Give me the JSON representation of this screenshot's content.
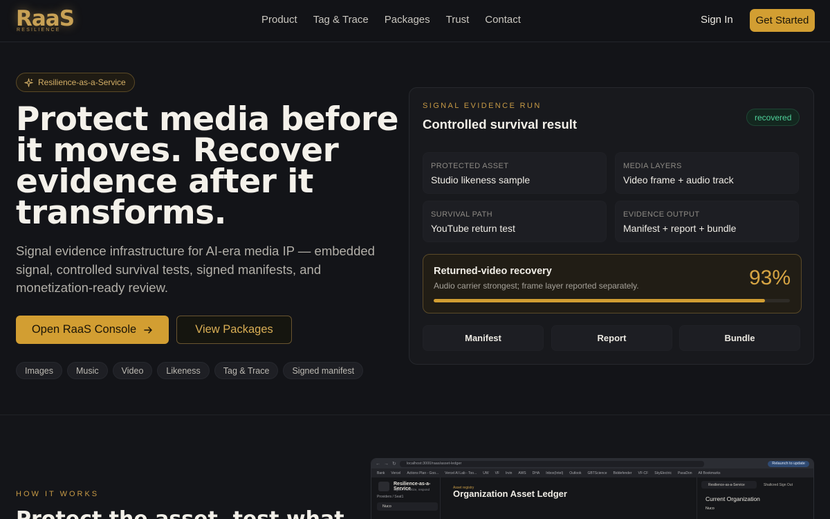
{
  "nav": {
    "logo": "RaaS",
    "logo_sub": "RESILIENCE",
    "links": [
      "Product",
      "Tag & Trace",
      "Packages",
      "Trust",
      "Contact"
    ],
    "sign_in": "Sign In",
    "get_started": "Get Started"
  },
  "hero": {
    "badge": "Resilience-as-a-Service",
    "title": "Protect media before it moves. Recover evidence after it transforms.",
    "subtitle": "Signal evidence infrastructure for AI-era media IP — embedded signal, controlled survival tests, signed manifests, and monetization-ready review.",
    "primary_button": "Open RaaS Console",
    "secondary_button": "View Packages",
    "tags": [
      "Images",
      "Music",
      "Video",
      "Likeness",
      "Tag & Trace",
      "Signed manifest"
    ]
  },
  "card": {
    "eyebrow": "SIGNAL EVIDENCE RUN",
    "title": "Controlled survival result",
    "status": "recovered",
    "stats": [
      {
        "label": "PROTECTED ASSET",
        "value": "Studio likeness sample"
      },
      {
        "label": "MEDIA LAYERS",
        "value": "Video frame + audio track"
      },
      {
        "label": "SURVIVAL PATH",
        "value": "YouTube return test"
      },
      {
        "label": "EVIDENCE OUTPUT",
        "value": "Manifest + report + bundle"
      }
    ],
    "recovery": {
      "title": "Returned-video recovery",
      "subtitle": "Audio carrier strongest; frame layer reported separately.",
      "percent_label": "93%",
      "progress": 0.93
    },
    "buttons": [
      "Manifest",
      "Report",
      "Bundle"
    ]
  },
  "how": {
    "eyebrow": "HOW IT WORKS",
    "title": "Protect the asset, test what"
  },
  "screenshot": {
    "url": "localhost:3000/raas/asset-ledger",
    "update": "Relaunch to update",
    "bookmarks": [
      "Bank",
      "Vercel",
      "Actions Plan - Goo...",
      "Vercel AI Lab - Too...",
      "UW",
      "VF",
      "Irvin",
      "AWS",
      "DHA",
      "Inbox(Intel)",
      "Outlook",
      "GBTScience",
      "Biddefender",
      "VF-CF",
      "SkyElectric",
      "PasaDon",
      "All Bookmarks"
    ],
    "app_name": "Resilience-as-a-Service",
    "app_tagline": "Signal, monetize, respond",
    "providers": "Providers / Seat1",
    "org": "Nuco",
    "ledger_eyebrow": "Asset registry",
    "ledger_title": "Organization Asset Ledger",
    "selector": "Resilience-as-a-Service",
    "top_links": "Shaltcred    Sign Out",
    "current_org": "Current Organization",
    "current_org_name": "Nuco"
  }
}
